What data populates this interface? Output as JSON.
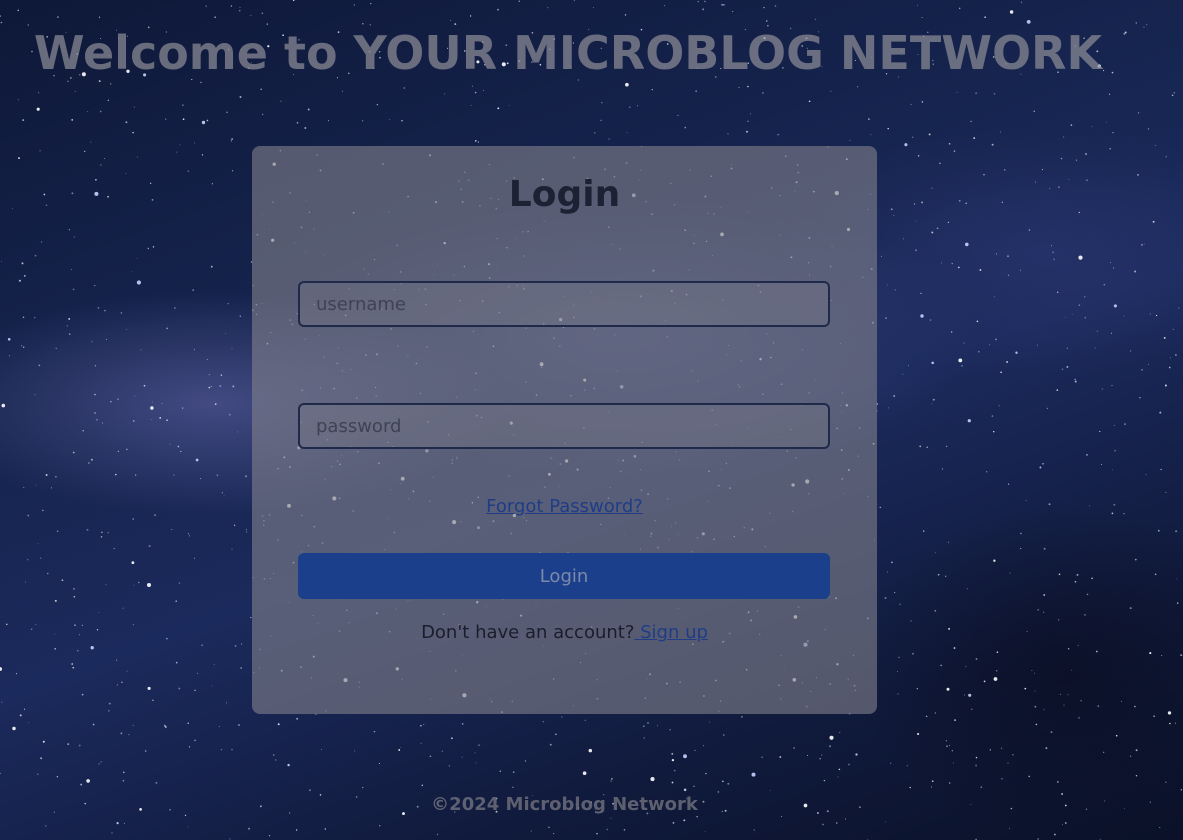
{
  "page": {
    "heading": "Welcome to YOUR MICROBLOG NETWORK"
  },
  "login": {
    "title": "Login",
    "username_placeholder": "username",
    "password_placeholder": "password",
    "forgot_label": "Forgot Password?",
    "submit_label": "Login",
    "signup_prompt": "Don't have an account?",
    "signup_link": " Sign up"
  },
  "footer": {
    "text": "©2024 Microblog Network"
  },
  "colors": {
    "button": "#1b3f8a",
    "link": "#1f3d86",
    "card": "#80808a"
  }
}
